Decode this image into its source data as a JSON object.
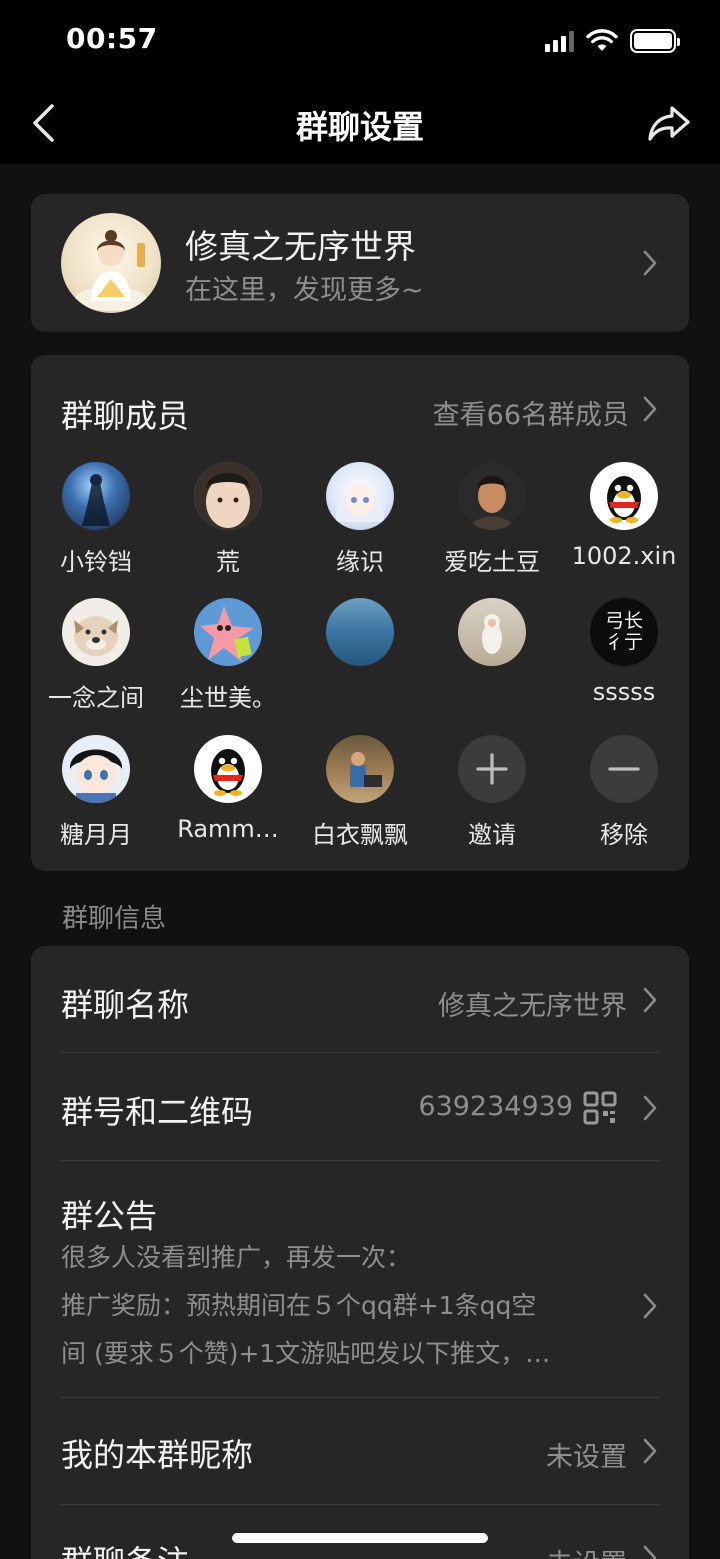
{
  "status_bar": {
    "time": "00:57",
    "battery_level": 1.0
  },
  "nav": {
    "title": "群聊设置"
  },
  "group": {
    "name": "修真之无序世界",
    "subtitle": "在这里，发现更多~"
  },
  "members_section": {
    "title": "群聊成员",
    "view_all": "查看66名群成员",
    "members": [
      {
        "name": "小铃铛",
        "avatar": "anime-warrior-avatar"
      },
      {
        "name": "荒",
        "avatar": "child-photo-avatar"
      },
      {
        "name": "缘识",
        "avatar": "anime-girl-avatar"
      },
      {
        "name": "爱吃土豆",
        "avatar": "cartoon-man-avatar"
      },
      {
        "name": "1002.xin",
        "avatar": "qq-penguin-avatar"
      },
      {
        "name": "一念之间",
        "avatar": "bulldog-avatar"
      },
      {
        "name": "尘世美。",
        "avatar": "patrick-star-avatar"
      },
      {
        "name": "",
        "avatar": "sea-avatar"
      },
      {
        "name": "",
        "avatar": "child-hoodie-avatar"
      },
      {
        "name": "sssss",
        "avatar": "calligraphy-avatar"
      },
      {
        "name": "糖月月",
        "avatar": "anime-boy-avatar"
      },
      {
        "name": "Ramm…",
        "avatar": "qq-penguin-avatar"
      },
      {
        "name": "白衣飘飘",
        "avatar": "outdoor-kid-avatar"
      }
    ],
    "calligraphy_text": "弓长 彳亍",
    "invite_label": "邀请",
    "remove_label": "移除"
  },
  "info_section_label": "群聊信息",
  "info": {
    "group_name_label": "群聊名称",
    "group_name_value": "修真之无序世界",
    "group_id_label": "群号和二维码",
    "group_id_value": "639234939",
    "notice_label": "群公告",
    "notice_line1": "很多人没看到推广，再发一次：",
    "notice_line2": "推广奖励：预热期间在５个qq群+1条qq空",
    "notice_line3": "间 (要求５个赞)+1文游贴吧发以下推文，…",
    "nickname_label": "我的本群昵称",
    "nickname_value": "未设置",
    "remark_label": "群聊备注",
    "remark_value": "未设置"
  }
}
